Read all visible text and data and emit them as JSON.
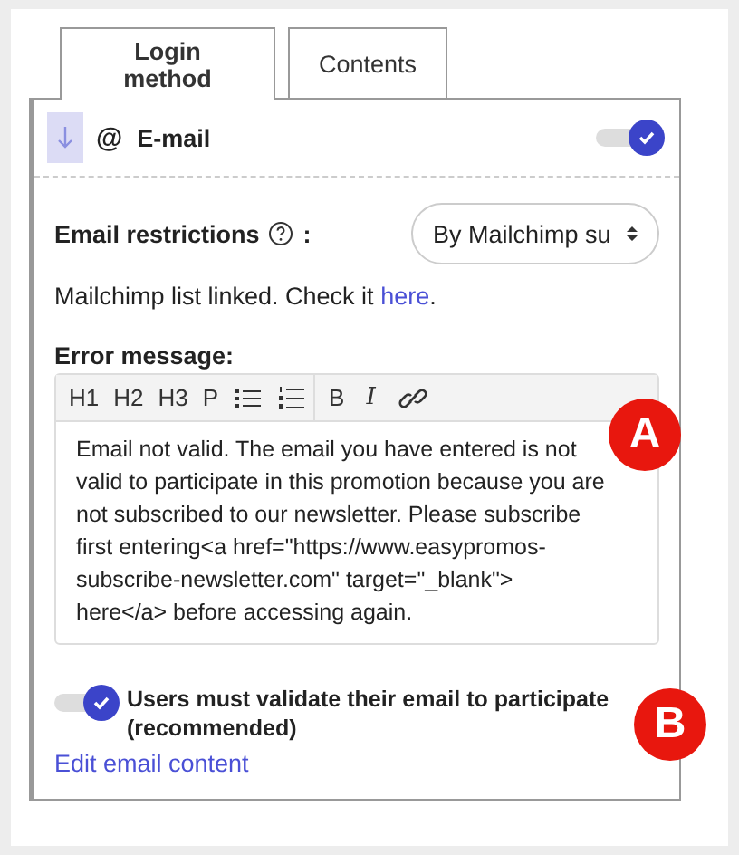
{
  "tabs": [
    {
      "label": "Login method",
      "selected": true
    },
    {
      "label": "Contents",
      "selected": false
    }
  ],
  "method": {
    "icon_text": "@",
    "title": "E-mail",
    "enabled": true
  },
  "restrictions": {
    "label": "Email restrictions",
    "colon": ":",
    "value": "By Mailchimp su"
  },
  "linked_note": {
    "text": "Mailchimp list linked. Check it",
    "link": "here",
    "end": "."
  },
  "error_message": {
    "label": "Error message:",
    "toolbar": [
      "H1",
      "H2",
      "H3",
      "P"
    ],
    "toolbar_text": [
      "B",
      "I"
    ],
    "value": "Email not valid. The email you have entered is not valid to participate in this promotion because you are not subscribed to our newsletter. Please subscribe first entering<a href=\"https://www.easypromos-subscribe-newsletter.com\" target=\"_blank\"> here</a> before accessing again."
  },
  "validate": {
    "label": "Users must validate their email to participate (recommended)",
    "on": true
  },
  "edit_link": "Edit email content",
  "markers": [
    "A",
    "B"
  ]
}
